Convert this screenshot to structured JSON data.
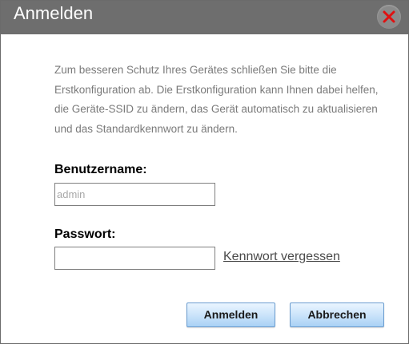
{
  "dialog": {
    "title": "Anmelden",
    "close_icon": "close-icon",
    "info_text": "Zum besseren Schutz Ihres Gerätes schließen Sie bitte die Erstkonfiguration ab. Die Erstkonfiguration kann Ihnen dabei helfen, die Geräte-SSID zu ändern, das Gerät automatisch zu aktualisieren und das Standardkennwort zu ändern."
  },
  "form": {
    "username_label": "Benutzername:",
    "username_placeholder": "admin",
    "username_value": "",
    "password_label": "Passwort:",
    "password_value": "",
    "forgot_link": "Kennwort vergessen"
  },
  "buttons": {
    "login_label": "Anmelden",
    "cancel_label": "Abbrechen"
  },
  "colors": {
    "titlebar": "#6e6e6e",
    "close_x": "#e01010",
    "button_blue": "#a9d1f5",
    "info_text": "#7a7a7a"
  }
}
